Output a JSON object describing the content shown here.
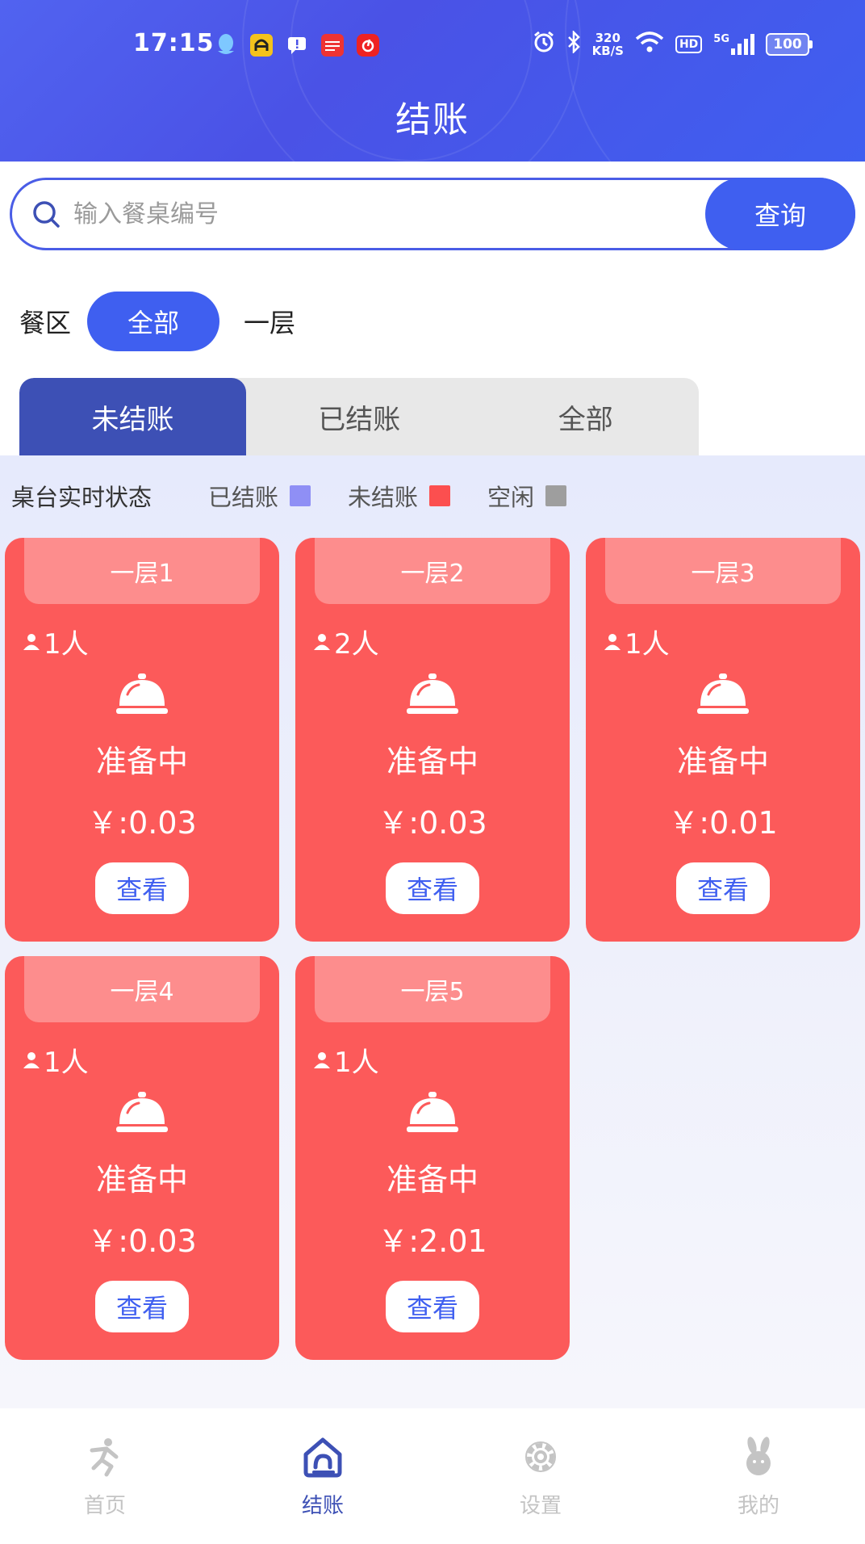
{
  "status_bar": {
    "time": "17:15",
    "speed_value": "320",
    "speed_unit": "KB/S",
    "hd": "HD",
    "network": "5G",
    "battery": "100"
  },
  "header": {
    "title": "结账"
  },
  "search": {
    "placeholder": "输入餐桌编号",
    "button": "查询"
  },
  "area": {
    "label": "餐区",
    "options": [
      "全部",
      "一层"
    ],
    "selected": "全部"
  },
  "tabs": [
    {
      "label": "未结账",
      "active": true
    },
    {
      "label": "已结账",
      "active": false
    },
    {
      "label": "全部",
      "active": false
    }
  ],
  "legend": {
    "title": "桌台实时状态",
    "items": [
      {
        "label": "已结账",
        "color": "#8f8ff5"
      },
      {
        "label": "未结账",
        "color": "#fc4f4f"
      },
      {
        "label": "空闲",
        "color": "#9e9e9e"
      }
    ]
  },
  "tables": [
    {
      "name": "一层1",
      "people": "1人",
      "status": "准备中",
      "price": "￥:0.03",
      "button": "查看"
    },
    {
      "name": "一层2",
      "people": "2人",
      "status": "准备中",
      "price": "￥:0.03",
      "button": "查看"
    },
    {
      "name": "一层3",
      "people": "1人",
      "status": "准备中",
      "price": "￥:0.01",
      "button": "查看"
    },
    {
      "name": "一层4",
      "people": "1人",
      "status": "准备中",
      "price": "￥:0.03",
      "button": "查看"
    },
    {
      "name": "一层5",
      "people": "1人",
      "status": "准备中",
      "price": "￥:2.01",
      "button": "查看"
    }
  ],
  "bottom_nav": [
    {
      "label": "首页",
      "icon": "runner-icon",
      "active": false
    },
    {
      "label": "结账",
      "icon": "home-checkout-icon",
      "active": true
    },
    {
      "label": "设置",
      "icon": "gear-icon",
      "active": false
    },
    {
      "label": "我的",
      "icon": "rabbit-profile-icon",
      "active": false
    }
  ],
  "colors": {
    "primary": "#3f5ff0",
    "tab_active": "#3d50b5",
    "card_red": "#fc5a5a",
    "card_title": "#fd8d8d"
  }
}
